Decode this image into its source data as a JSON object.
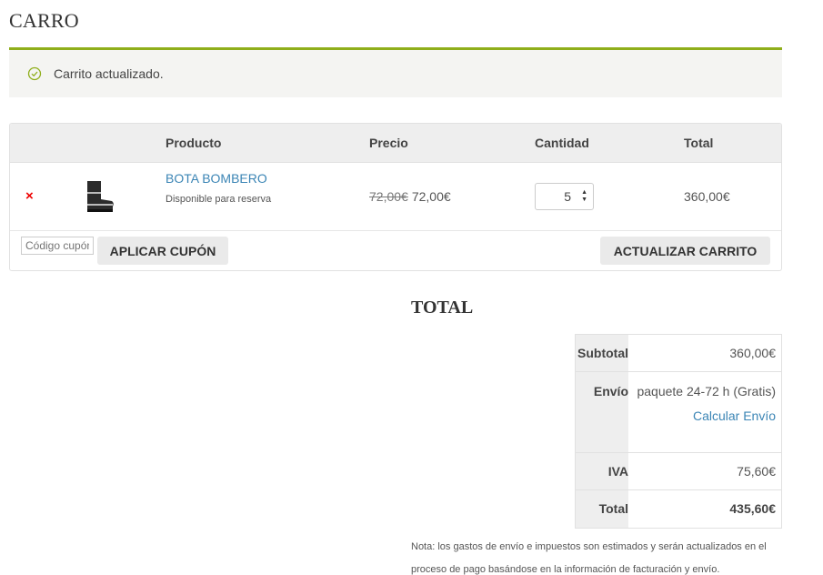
{
  "page": {
    "title": "CARRO"
  },
  "notice": {
    "text": "Carrito actualizado.",
    "icon": "check-circle-icon",
    "accent_color": "#8fae1b"
  },
  "cart": {
    "headers": {
      "product": "Producto",
      "price": "Precio",
      "quantity": "Cantidad",
      "total": "Total"
    },
    "items": [
      {
        "remove_label": "×",
        "name": "BOTA BOMBERO",
        "availability": "Disponible para reserva",
        "old_price": "72,00€",
        "price": "72,00€",
        "quantity": "5",
        "total": "360,00€",
        "thumbnail": "boot-image"
      }
    ],
    "coupon": {
      "placeholder": "Código cupón"
    },
    "apply_coupon_label": "APLICAR CUPÓN",
    "update_cart_label": "ACTUALIZAR CARRITO"
  },
  "totals": {
    "title": "TOTAL",
    "subtotal_label": "Subtotal",
    "subtotal_value": "360,00€",
    "shipping_label": "Envío",
    "shipping_value": "paquete 24-72 h (Gratis)",
    "shipping_link": "Calcular Envío",
    "tax_label": "IVA",
    "tax_value": "75,60€",
    "total_label": "Total",
    "total_value": "435,60€"
  },
  "note": "Nota: los gastos de envío e impuestos son estimados y serán actualizados en el proceso de pago basándose en la información de facturación y envío."
}
